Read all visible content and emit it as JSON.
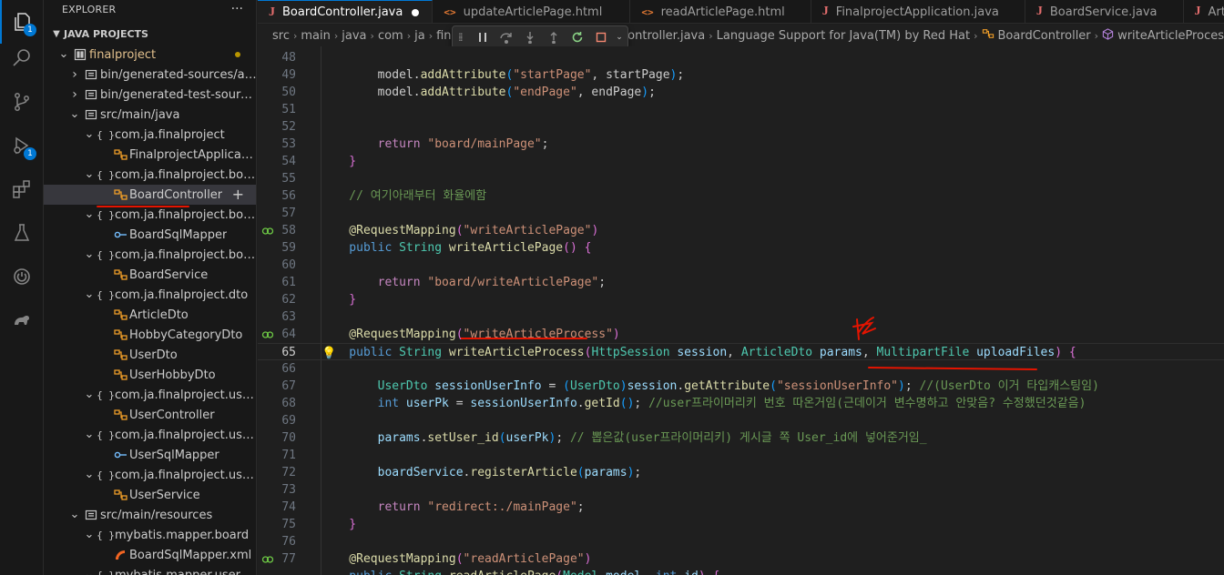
{
  "activity_bar": {
    "explorer_badge": "1",
    "debug_badge": "1"
  },
  "sidebar": {
    "header": "EXPLORER",
    "more": "···",
    "section": "JAVA PROJECTS",
    "tree": [
      {
        "label": "finalproject",
        "depth": 0,
        "twisty": "open",
        "icon": "project",
        "modified": true
      },
      {
        "label": "bin/generated-sources/an...",
        "depth": 1,
        "twisty": "closed",
        "icon": "folder"
      },
      {
        "label": "bin/generated-test-sourc...",
        "depth": 1,
        "twisty": "closed",
        "icon": "folder"
      },
      {
        "label": "src/main/java",
        "depth": 1,
        "twisty": "open",
        "icon": "folder"
      },
      {
        "label": "com.ja.finalproject",
        "depth": 2,
        "twisty": "open",
        "icon": "package"
      },
      {
        "label": "FinalprojectApplication",
        "depth": 3,
        "twisty": "",
        "icon": "class"
      },
      {
        "label": "com.ja.finalproject.boar...",
        "depth": 2,
        "twisty": "open",
        "icon": "package"
      },
      {
        "label": "BoardController",
        "depth": 3,
        "twisty": "",
        "icon": "class",
        "selected": true
      },
      {
        "label": "com.ja.finalproject.boar...",
        "depth": 2,
        "twisty": "open",
        "icon": "package"
      },
      {
        "label": "BoardSqlMapper",
        "depth": 3,
        "twisty": "",
        "icon": "interface"
      },
      {
        "label": "com.ja.finalproject.boar...",
        "depth": 2,
        "twisty": "open",
        "icon": "package"
      },
      {
        "label": "BoardService",
        "depth": 3,
        "twisty": "",
        "icon": "class"
      },
      {
        "label": "com.ja.finalproject.dto",
        "depth": 2,
        "twisty": "open",
        "icon": "package"
      },
      {
        "label": "ArticleDto",
        "depth": 3,
        "twisty": "",
        "icon": "class"
      },
      {
        "label": "HobbyCategoryDto",
        "depth": 3,
        "twisty": "",
        "icon": "class"
      },
      {
        "label": "UserDto",
        "depth": 3,
        "twisty": "",
        "icon": "class"
      },
      {
        "label": "UserHobbyDto",
        "depth": 3,
        "twisty": "",
        "icon": "class"
      },
      {
        "label": "com.ja.finalproject.user.c...",
        "depth": 2,
        "twisty": "open",
        "icon": "package"
      },
      {
        "label": "UserController",
        "depth": 3,
        "twisty": "",
        "icon": "class"
      },
      {
        "label": "com.ja.finalproject.user....",
        "depth": 2,
        "twisty": "open",
        "icon": "package"
      },
      {
        "label": "UserSqlMapper",
        "depth": 3,
        "twisty": "",
        "icon": "interface"
      },
      {
        "label": "com.ja.finalproject.user.s...",
        "depth": 2,
        "twisty": "open",
        "icon": "package"
      },
      {
        "label": "UserService",
        "depth": 3,
        "twisty": "",
        "icon": "class"
      },
      {
        "label": "src/main/resources",
        "depth": 1,
        "twisty": "open",
        "icon": "folder"
      },
      {
        "label": "mybatis.mapper.board",
        "depth": 2,
        "twisty": "open",
        "icon": "package"
      },
      {
        "label": "BoardSqlMapper.xml",
        "depth": 3,
        "twisty": "",
        "icon": "xml"
      },
      {
        "label": "mybatis.mapper.user",
        "depth": 2,
        "twisty": "open",
        "icon": "package"
      }
    ]
  },
  "tabs": [
    {
      "label": "BoardController.java",
      "type": "java",
      "active": true,
      "dirty": true
    },
    {
      "label": "updateArticlePage.html",
      "type": "html"
    },
    {
      "label": "readArticlePage.html",
      "type": "html"
    },
    {
      "label": "FinalprojectApplication.java",
      "type": "java"
    },
    {
      "label": "BoardService.java",
      "type": "java"
    },
    {
      "label": "ArticleDto.java",
      "type": "java"
    }
  ],
  "breadcrumb": {
    "left": [
      "src",
      "main",
      "java",
      "com",
      "ja",
      "fin"
    ],
    "right": [
      "BoardController.java",
      "Language Support for Java(TM) by Red Hat",
      "BoardController",
      "writeArticleProces"
    ]
  },
  "editor": {
    "lines": [
      {
        "n": "48",
        "tokens": []
      },
      {
        "n": "49",
        "tokens": [
          [
            "",
            "        model."
          ],
          [
            "fn",
            "addAttribute"
          ],
          [
            "pn3",
            "("
          ],
          [
            "st",
            "\"startPage\""
          ],
          [
            "",
            ", startPage"
          ],
          [
            "pn3",
            ")"
          ],
          [
            "",
            ";"
          ]
        ]
      },
      {
        "n": "50",
        "tokens": [
          [
            "",
            "        model."
          ],
          [
            "fn",
            "addAttribute"
          ],
          [
            "pn3",
            "("
          ],
          [
            "st",
            "\"endPage\""
          ],
          [
            "",
            ", endPage"
          ],
          [
            "pn3",
            ")"
          ],
          [
            "",
            ";"
          ]
        ]
      },
      {
        "n": "51",
        "tokens": []
      },
      {
        "n": "52",
        "tokens": []
      },
      {
        "n": "53",
        "tokens": [
          [
            "kw2",
            "        return "
          ],
          [
            "st",
            "\"board/mainPage\""
          ],
          [
            "",
            ";"
          ]
        ]
      },
      {
        "n": "54",
        "tokens": [
          [
            "pn2",
            "    }"
          ]
        ]
      },
      {
        "n": "55",
        "tokens": []
      },
      {
        "n": "56",
        "tokens": [
          [
            "cm",
            "    // 여기아래부터 화율에함"
          ]
        ]
      },
      {
        "n": "57",
        "tokens": []
      },
      {
        "n": "58",
        "gutter": "run",
        "tokens": [
          [
            "an",
            "    @RequestMapping"
          ],
          [
            "pn2",
            "("
          ],
          [
            "st",
            "\"writeArticlePage\""
          ],
          [
            "pn2",
            ")"
          ]
        ]
      },
      {
        "n": "59",
        "tokens": [
          [
            "kw",
            "    public "
          ],
          [
            "ty",
            "String "
          ],
          [
            "fn",
            "writeArticlePage"
          ],
          [
            "pn2",
            "() {"
          ]
        ]
      },
      {
        "n": "60",
        "tokens": []
      },
      {
        "n": "61",
        "tokens": [
          [
            "kw2",
            "        return "
          ],
          [
            "st",
            "\"board/writeArticlePage\""
          ],
          [
            "",
            ";"
          ]
        ]
      },
      {
        "n": "62",
        "tokens": [
          [
            "pn2",
            "    }"
          ]
        ]
      },
      {
        "n": "63",
        "tokens": []
      },
      {
        "n": "64",
        "gutter": "run",
        "tokens": [
          [
            "an",
            "    @RequestMapping"
          ],
          [
            "pn2",
            "("
          ],
          [
            "st",
            "\"writeArticleProcess\""
          ],
          [
            "pn2",
            ")"
          ]
        ]
      },
      {
        "n": "65",
        "current": true,
        "bulb": true,
        "tokens": [
          [
            "kw",
            "    public "
          ],
          [
            "ty",
            "String "
          ],
          [
            "fn",
            "writeArticleProcess"
          ],
          [
            "pn2",
            "("
          ],
          [
            "ty",
            "HttpSession "
          ],
          [
            "vr",
            "session"
          ],
          [
            "",
            ", "
          ],
          [
            "ty",
            "ArticleDto "
          ],
          [
            "vr",
            "params"
          ],
          [
            "",
            ", "
          ],
          [
            "ty",
            "MultipartFile "
          ],
          [
            "vr",
            "uploadFiles"
          ],
          [
            "pn2",
            ") {"
          ]
        ]
      },
      {
        "n": "66",
        "tokens": []
      },
      {
        "n": "67",
        "tokens": [
          [
            "ty",
            "        UserDto "
          ],
          [
            "vr",
            "sessionUserInfo"
          ],
          [
            "",
            " = "
          ],
          [
            "pn3",
            "("
          ],
          [
            "ty",
            "UserDto"
          ],
          [
            "pn3",
            ")"
          ],
          [
            "vr",
            "session"
          ],
          [
            "",
            "."
          ],
          [
            "fn",
            "getAttribute"
          ],
          [
            "pn3",
            "("
          ],
          [
            "st",
            "\"sessionUserInfo\""
          ],
          [
            "pn3",
            ")"
          ],
          [
            "",
            "; "
          ],
          [
            "cm",
            "//(UserDto 이거 타입캐스팅임)"
          ]
        ]
      },
      {
        "n": "68",
        "tokens": [
          [
            "kw",
            "        int "
          ],
          [
            "vr",
            "userPk"
          ],
          [
            "",
            " = "
          ],
          [
            "vr",
            "sessionUserInfo"
          ],
          [
            "",
            "."
          ],
          [
            "fn",
            "getId"
          ],
          [
            "pn3",
            "()"
          ],
          [
            "",
            "; "
          ],
          [
            "cm",
            "//user프라이머리키 번호 따온거임(근데이거 변수명하고 안맞음? 수정했던것같음)"
          ]
        ]
      },
      {
        "n": "69",
        "tokens": []
      },
      {
        "n": "70",
        "tokens": [
          [
            "vr",
            "        params"
          ],
          [
            "",
            "."
          ],
          [
            "fn",
            "setUser_id"
          ],
          [
            "pn3",
            "("
          ],
          [
            "vr",
            "userPk"
          ],
          [
            "pn3",
            ")"
          ],
          [
            "",
            "; "
          ],
          [
            "cm",
            "// 뽑은값(user프라이머리키) 게시글 쪽 User_id에 넣어준거임_"
          ]
        ]
      },
      {
        "n": "71",
        "tokens": []
      },
      {
        "n": "72",
        "tokens": [
          [
            "vr",
            "        boardService"
          ],
          [
            "",
            "."
          ],
          [
            "fn",
            "registerArticle"
          ],
          [
            "pn3",
            "("
          ],
          [
            "vr",
            "params"
          ],
          [
            "pn3",
            ")"
          ],
          [
            "",
            ";"
          ]
        ]
      },
      {
        "n": "73",
        "tokens": []
      },
      {
        "n": "74",
        "tokens": [
          [
            "kw2",
            "        return "
          ],
          [
            "st",
            "\"redirect:./mainPage\""
          ],
          [
            "",
            ";"
          ]
        ]
      },
      {
        "n": "75",
        "tokens": [
          [
            "pn2",
            "    }"
          ]
        ]
      },
      {
        "n": "76",
        "tokens": []
      },
      {
        "n": "77",
        "gutter": "run",
        "tokens": [
          [
            "an",
            "    @RequestMapping"
          ],
          [
            "pn2",
            "("
          ],
          [
            "st",
            "\"readArticlePage\""
          ],
          [
            "pn2",
            ")"
          ]
        ]
      },
      {
        "n": "",
        "tokens": [
          [
            "kw",
            "    public "
          ],
          [
            "ty",
            "String "
          ],
          [
            "fn",
            "readArticlePage"
          ],
          [
            "pn2",
            "("
          ],
          [
            "ty",
            "Model "
          ],
          [
            "vr",
            "model"
          ],
          [
            "",
            ", "
          ],
          [
            "kw",
            "int "
          ],
          [
            "vr",
            "id"
          ],
          [
            "pn2",
            ") {"
          ]
        ]
      }
    ]
  },
  "colors": {
    "accent": "#0078d4",
    "annotation": "#e51400",
    "editor_bg": "#1f1f1f",
    "sidebar_bg": "#181818"
  }
}
